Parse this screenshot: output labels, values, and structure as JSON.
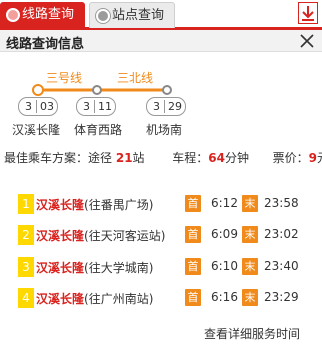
{
  "tabs": {
    "route_query": "线路查询",
    "stop_query": "站点查询"
  },
  "header": {
    "title": "线路查询信息"
  },
  "route": {
    "lines": [
      "三号线",
      "三北线"
    ],
    "stations": [
      {
        "name": "汉溪长隆",
        "line_no": "3",
        "code": "03"
      },
      {
        "name": "体育西路",
        "line_no": "3",
        "code": "11"
      },
      {
        "name": "机场南",
        "line_no": "3",
        "code": "29"
      }
    ],
    "line_color": "#f08a1a"
  },
  "summary": {
    "best_label": "最佳乘车方案：途径",
    "stops": "21",
    "stops_unit": "站",
    "time_label": "车程：",
    "minutes": "64",
    "minutes_unit": "分钟",
    "fare_label": "票价：",
    "fare": "9",
    "fare_unit": "元"
  },
  "first_label": "首",
  "last_label": "末",
  "services": [
    {
      "no": "1",
      "origin": "汉溪长隆",
      "dest": "(往番禺广场)",
      "first": "6:12",
      "last": "23:58"
    },
    {
      "no": "2",
      "origin": "汉溪长隆",
      "dest": "(往天河客运站)",
      "first": "6:09",
      "last": "23:02"
    },
    {
      "no": "3",
      "origin": "汉溪长隆",
      "dest": "(往大学城南)",
      "first": "6:10",
      "last": "23:40"
    },
    {
      "no": "4",
      "origin": "汉溪长隆",
      "dest": "(往广州南站)",
      "first": "6:16",
      "last": "23:29"
    }
  ],
  "detail_link": "查看详细服务时间",
  "colors": {
    "accent": "#d8231f",
    "orange": "#f08a1a",
    "badge": "#ffd800"
  }
}
